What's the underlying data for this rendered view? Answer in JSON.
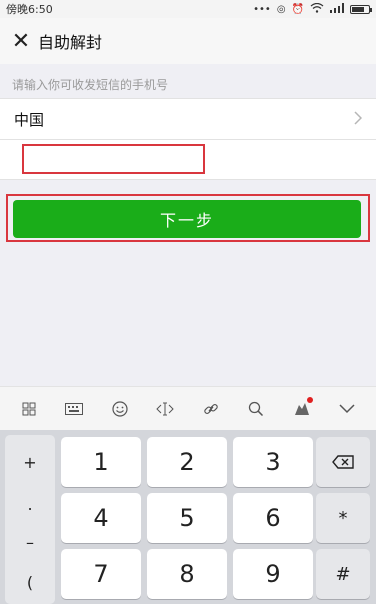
{
  "status_bar": {
    "time": "傍晚6:50",
    "icons": [
      "more-dots-icon",
      "link-icon",
      "alarm-icon",
      "wifi-icon",
      "signal-icon",
      "battery-icon"
    ]
  },
  "navbar": {
    "close_icon": "close-icon",
    "title": "自助解封"
  },
  "form": {
    "hint": "请输入你可收发短信的手机号",
    "country": "中国",
    "phone_value": "",
    "phone_placeholder": ""
  },
  "next_button": {
    "label": "下一步",
    "color": "#1aad19"
  },
  "keyboard_toolbar": {
    "icons": [
      "grid-icon",
      "keyboard-icon",
      "emoji-icon",
      "cursor-icon",
      "link-icon",
      "search-icon",
      "skin-icon",
      "collapse-chevron-icon"
    ]
  },
  "keyboard": {
    "side_keys": [
      "+",
      ".",
      "–",
      "("
    ],
    "digits": [
      "1",
      "2",
      "3",
      "4",
      "5",
      "6",
      "7",
      "8",
      "9"
    ],
    "right_keys": [
      "⌫",
      "*",
      "#"
    ]
  }
}
